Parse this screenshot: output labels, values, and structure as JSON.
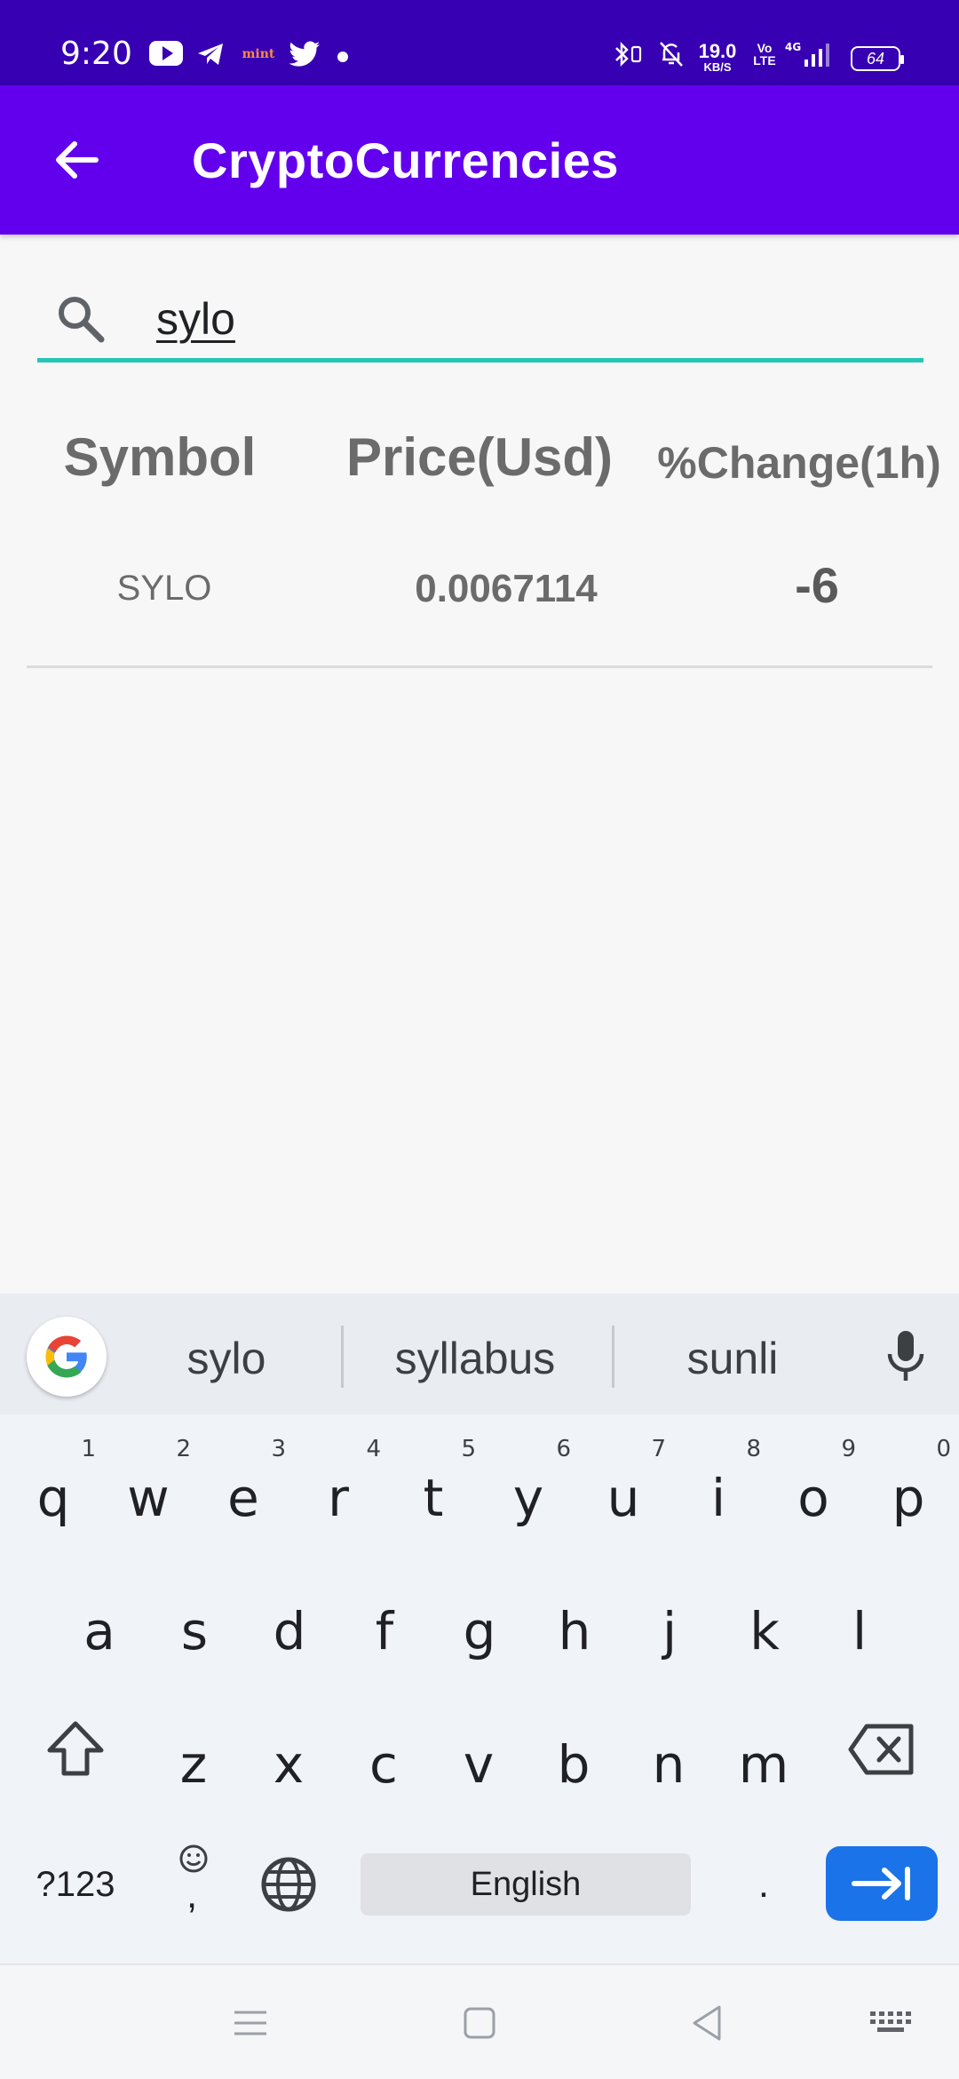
{
  "status_bar": {
    "time": "9:20",
    "notification_icons": [
      "youtube-icon",
      "telegram-icon",
      "mint-icon",
      "twitter-icon",
      "dot-icon"
    ],
    "mint_label": "mint",
    "net_speed_value": "19.0",
    "net_speed_unit": "KB/S",
    "volte_top": "Vo",
    "volte_bottom": "LTE",
    "network": "4G",
    "battery": "64"
  },
  "app_bar": {
    "title": "CryptoCurrencies",
    "background": "#6200ee"
  },
  "search": {
    "value": "sylo",
    "underline_color": "#26c6b4"
  },
  "table": {
    "headers": {
      "symbol": "Symbol",
      "price": "Price(Usd)",
      "change": "%Change(1h)"
    },
    "rows": [
      {
        "symbol": "SYLO",
        "price": "0.0067114",
        "change": "-6"
      }
    ]
  },
  "keyboard": {
    "suggestions": [
      "sylo",
      "syllabus",
      "sunli"
    ],
    "row1": [
      {
        "k": "q",
        "n": "1"
      },
      {
        "k": "w",
        "n": "2"
      },
      {
        "k": "e",
        "n": "3"
      },
      {
        "k": "r",
        "n": "4"
      },
      {
        "k": "t",
        "n": "5"
      },
      {
        "k": "y",
        "n": "6"
      },
      {
        "k": "u",
        "n": "7"
      },
      {
        "k": "i",
        "n": "8"
      },
      {
        "k": "o",
        "n": "9"
      },
      {
        "k": "p",
        "n": "0"
      }
    ],
    "row2": [
      "a",
      "s",
      "d",
      "f",
      "g",
      "h",
      "j",
      "k",
      "l"
    ],
    "row3": [
      "z",
      "x",
      "c",
      "v",
      "b",
      "n",
      "m"
    ],
    "symbols_label": "?123",
    "comma_label": ",",
    "space_label": "English",
    "period_label": ".",
    "enter_color": "#1a73e8"
  }
}
